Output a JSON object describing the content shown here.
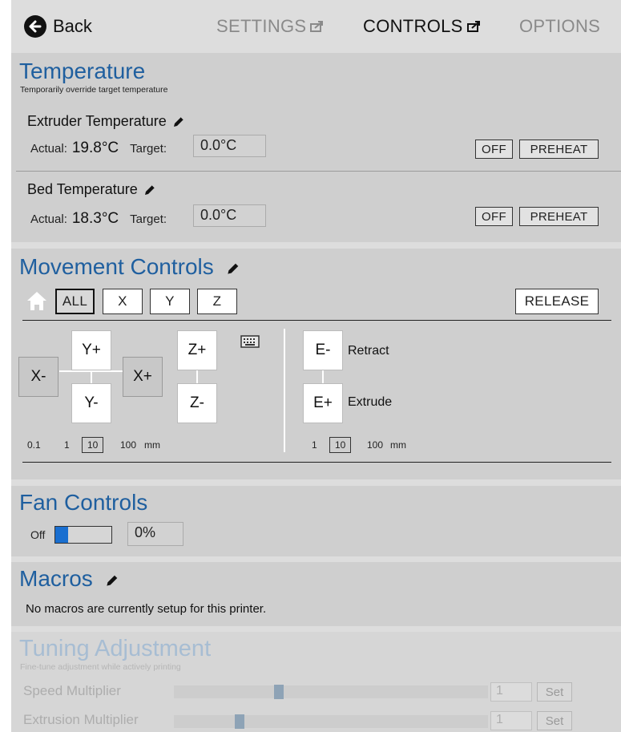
{
  "header": {
    "back_label": "Back",
    "tabs": [
      {
        "label": "SETTINGS",
        "active": false
      },
      {
        "label": "CONTROLS",
        "active": true
      },
      {
        "label": "OPTIONS",
        "active": false
      }
    ]
  },
  "temperature": {
    "title": "Temperature",
    "subtitle": "Temporarily override target temperature",
    "extruder": {
      "label": "Extruder Temperature",
      "actual_label": "Actual:",
      "actual_value": "19.8°C",
      "target_label": "Target:",
      "target_value": "0.0°C",
      "off_label": "OFF",
      "preheat_label": "PREHEAT"
    },
    "bed": {
      "label": "Bed Temperature",
      "actual_label": "Actual:",
      "actual_value": "18.3°C",
      "target_label": "Target:",
      "target_value": "0.0°C",
      "off_label": "OFF",
      "preheat_label": "PREHEAT"
    }
  },
  "movement": {
    "title": "Movement Controls",
    "home_buttons": [
      "ALL",
      "X",
      "Y",
      "Z"
    ],
    "release_label": "RELEASE",
    "jog": {
      "x_minus": "X-",
      "x_plus": "X+",
      "y_plus": "Y+",
      "y_minus": "Y-",
      "z_plus": "Z+",
      "z_minus": "Z-"
    },
    "xyz_steps": [
      "0.1",
      "1",
      "10",
      "100"
    ],
    "xyz_selected_step": "10",
    "xyz_unit": "mm",
    "extruder": {
      "e_minus": "E-",
      "e_plus": "E+",
      "retract_label": "Retract",
      "extrude_label": "Extrude"
    },
    "e_steps": [
      "1",
      "10",
      "100"
    ],
    "e_selected_step": "10",
    "e_unit": "mm"
  },
  "fan": {
    "title": "Fan Controls",
    "off_label": "Off",
    "speed_value": "0%",
    "speed_fraction": 0
  },
  "macros": {
    "title": "Macros",
    "empty_message": "No macros are currently setup for this printer."
  },
  "tuning": {
    "title": "Tuning Adjustment",
    "subtitle": "Fine-tune adjustment while actively printing",
    "speed": {
      "label": "Speed Multiplier",
      "value": "1",
      "set_label": "Set",
      "slider_fraction": 0.33
    },
    "extrusion": {
      "label": "Extrusion Multiplier",
      "value": "1",
      "set_label": "Set",
      "slider_fraction": 0.2
    }
  },
  "colors": {
    "accent_title": "#1f5f9f",
    "fan_thumb": "#1a6fd0",
    "panel_bg": "#cfcfcf",
    "page_bg": "#dddddd"
  }
}
